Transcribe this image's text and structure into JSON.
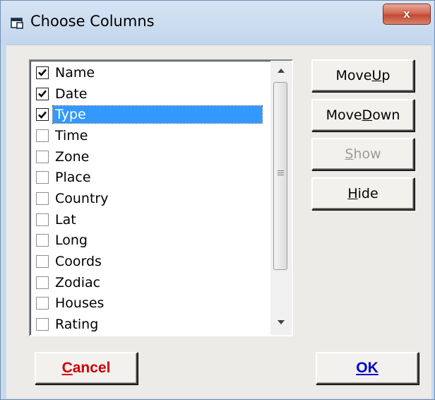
{
  "window": {
    "title": "Choose Columns",
    "close_label": "x"
  },
  "columns_list": {
    "items": [
      {
        "label": "Name",
        "checked": true,
        "selected": false
      },
      {
        "label": "Date",
        "checked": true,
        "selected": false
      },
      {
        "label": "Type",
        "checked": true,
        "selected": true
      },
      {
        "label": "Time",
        "checked": false,
        "selected": false
      },
      {
        "label": "Zone",
        "checked": false,
        "selected": false
      },
      {
        "label": "Place",
        "checked": false,
        "selected": false
      },
      {
        "label": "Country",
        "checked": false,
        "selected": false
      },
      {
        "label": "Lat",
        "checked": false,
        "selected": false
      },
      {
        "label": "Long",
        "checked": false,
        "selected": false
      },
      {
        "label": "Coords",
        "checked": false,
        "selected": false
      },
      {
        "label": "Zodiac",
        "checked": false,
        "selected": false
      },
      {
        "label": "Houses",
        "checked": false,
        "selected": false
      },
      {
        "label": "Rating",
        "checked": false,
        "selected": false
      }
    ]
  },
  "buttons": {
    "move_up": {
      "pre": "Move ",
      "mn": "U",
      "post": "p",
      "enabled": true
    },
    "move_down": {
      "pre": "Move ",
      "mn": "D",
      "post": "own",
      "enabled": true
    },
    "show": {
      "pre": "",
      "mn": "S",
      "post": "how",
      "enabled": false
    },
    "hide": {
      "pre": "",
      "mn": "H",
      "post": "ide",
      "enabled": true
    },
    "cancel": {
      "pre": "",
      "mn": "C",
      "post": "ancel",
      "color": "#d00000"
    },
    "ok": {
      "pre": "",
      "mn": "O",
      "post": "K",
      "color": "#0000cc"
    }
  },
  "colors": {
    "selection": "#3399ff",
    "window_frame": "#c9d9ec",
    "dialog_face": "#ecebe7"
  },
  "icons": {
    "title": "window-icon",
    "close": "close-icon",
    "scroll_up": "arrow-up-icon",
    "scroll_down": "arrow-down-icon",
    "check": "checkmark-icon"
  }
}
